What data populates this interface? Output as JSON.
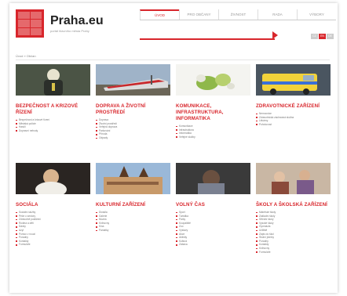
{
  "header": {
    "brand": "Praha.eu",
    "tagline": "portál hlavního města Prahy",
    "nav": [
      "ÚVOD",
      "PRO OBČANY",
      "ŽIVNOST",
      "RADA",
      "VÝBORY"
    ],
    "breadcrumb": "Úvod » Občan"
  },
  "lang": [
    "CZ",
    "EN",
    "DE"
  ],
  "colors": {
    "accent": "#d8262c"
  },
  "cards": [
    {
      "title": "BEZPEČNOST A KRIZOVÉ ŘÍZENÍ",
      "items": [
        "Bezpečnost a krizové řízení",
        "Městská policie",
        "Hasiči",
        "Dopravní nehody"
      ]
    },
    {
      "title": "DOPRAVA A ŽIVOTNÍ PROSTŘEDÍ",
      "items": [
        "Doprava",
        "Životní prostředí",
        "Veřejná doprava",
        "Parkování",
        "Příroda",
        "Odpady"
      ]
    },
    {
      "title": "KOMUNIKACE, INFRASTRUKTURA, INFORMATIKA",
      "items": [
        "Komunikace",
        "Infrastruktura",
        "Informatika",
        "Veřejné služby"
      ]
    },
    {
      "title": "ZDRAVOTNICKÉ ZAŘÍZENÍ",
      "items": [
        "Nemocnice",
        "Zdravotnická záchranná služba",
        "Lékárny",
        "Pohotovost"
      ]
    },
    {
      "title": "SOCIÁLA",
      "items": [
        "Sociální služby",
        "Péče o seniory",
        "Zdravotně postižení",
        "Rodina a děti",
        "Dávky",
        "Azyl",
        "Pomoc v nouzi",
        "Poradny",
        "Kontakty",
        "Formuláře"
      ]
    },
    {
      "title": "KULTURNÍ ZAŘÍZENÍ",
      "items": [
        "Divadla",
        "Galerie",
        "Muzea",
        "Knihovny",
        "Kina",
        "Památky"
      ]
    },
    {
      "title": "VOLNÝ ČAS",
      "items": [
        "Sport",
        "Turistika",
        "Parky",
        "Koupaliště",
        "Zoo",
        "Výstavy",
        "Akce",
        "Aktivity",
        "Kultura",
        "Zábava"
      ]
    },
    {
      "title": "ŠKOLY A ŠKOLSKÁ ZAŘÍZENÍ",
      "items": [
        "Mateřské školy",
        "Základní školy",
        "Střední školy",
        "Vysoké školy",
        "Gymnázia",
        "Učiliště",
        "Zápis do škol",
        "Školní jídelny",
        "Poradny",
        "Kontakty",
        "Knihovny",
        "Formuláře"
      ]
    }
  ]
}
